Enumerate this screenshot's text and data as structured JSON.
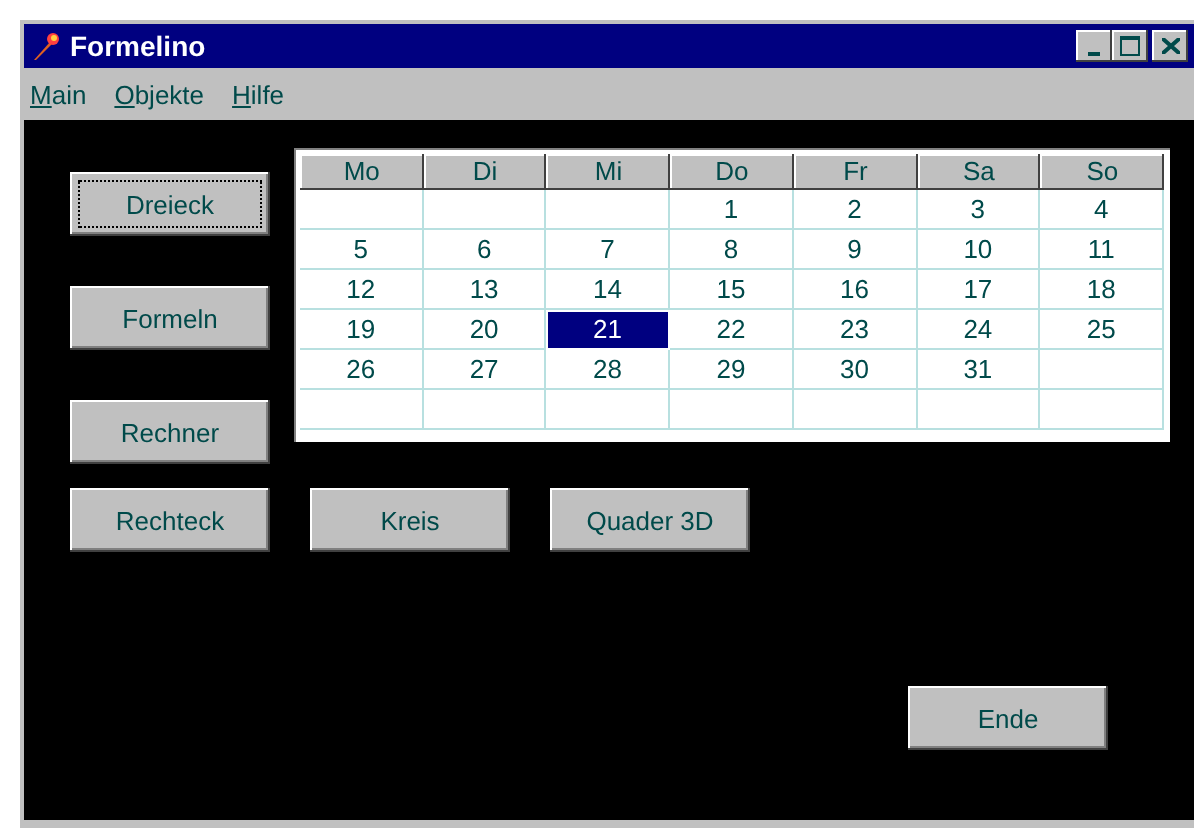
{
  "window": {
    "title": "Formelino"
  },
  "menu": [
    {
      "label": "Main"
    },
    {
      "label": "Objekte"
    },
    {
      "label": "Hilfe"
    }
  ],
  "side_buttons": [
    {
      "label": "Dreieck",
      "focused": true
    },
    {
      "label": "Formeln",
      "focused": false
    },
    {
      "label": "Rechner",
      "focused": false
    }
  ],
  "calendar": {
    "columns": [
      "Mo",
      "Di",
      "Mi",
      "Do",
      "Fr",
      "Sa",
      "So"
    ],
    "rows": [
      [
        null,
        null,
        null,
        {
          "text": "1",
          "selected": false
        },
        {
          "text": "2",
          "selected": false
        },
        {
          "text": "3",
          "selected": false
        },
        {
          "text": "4",
          "selected": false
        }
      ],
      [
        {
          "text": "5",
          "selected": false
        },
        {
          "text": "6",
          "selected": false
        },
        {
          "text": "7",
          "selected": false
        },
        {
          "text": "8",
          "selected": false
        },
        {
          "text": "9",
          "selected": false
        },
        {
          "text": "10",
          "selected": false
        },
        {
          "text": "11",
          "selected": false
        }
      ],
      [
        {
          "text": "12",
          "selected": false
        },
        {
          "text": "13",
          "selected": false
        },
        {
          "text": "14",
          "selected": false
        },
        {
          "text": "15",
          "selected": false
        },
        {
          "text": "16",
          "selected": false
        },
        {
          "text": "17",
          "selected": false
        },
        {
          "text": "18",
          "selected": false
        }
      ],
      [
        {
          "text": "19",
          "selected": false
        },
        {
          "text": "20",
          "selected": false
        },
        {
          "text": "21",
          "selected": true
        },
        {
          "text": "22",
          "selected": false
        },
        {
          "text": "23",
          "selected": false
        },
        {
          "text": "24",
          "selected": false
        },
        {
          "text": "25",
          "selected": false
        }
      ],
      [
        {
          "text": "26",
          "selected": false
        },
        {
          "text": "27",
          "selected": false
        },
        {
          "text": "28",
          "selected": false
        },
        {
          "text": "29",
          "selected": false
        },
        {
          "text": "30",
          "selected": false
        },
        {
          "text": "31",
          "selected": false
        },
        null
      ],
      [
        null,
        null,
        null,
        null,
        null,
        null,
        null
      ]
    ]
  },
  "bottom_buttons": [
    {
      "label": "Rechteck",
      "focused": false
    },
    {
      "label": "Kreis",
      "focused": false
    },
    {
      "label": "Quader 3D",
      "focused": false
    }
  ],
  "exit_button": {
    "label": "Ende",
    "focused": false
  }
}
